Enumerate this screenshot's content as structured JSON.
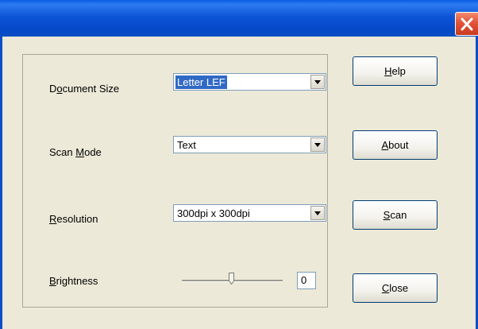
{
  "dialog": {
    "close_icon": "close-icon",
    "title_color": "#0a53d0",
    "close_color": "#e2553a"
  },
  "settings": {
    "document_size": {
      "label_pre": "D",
      "label_key": "o",
      "label_post": "cument Size",
      "value": "Letter LEF"
    },
    "scan_mode": {
      "label_pre": "Scan ",
      "label_key": "M",
      "label_post": "ode",
      "value": "Text"
    },
    "resolution": {
      "label_pre": "",
      "label_key": "R",
      "label_post": "esolution",
      "value": "300dpi x 300dpi"
    },
    "brightness": {
      "label_pre": "",
      "label_key": "B",
      "label_post": "rightness",
      "value": "0",
      "level": 0
    }
  },
  "buttons": {
    "help": {
      "key": "H",
      "rest": "elp"
    },
    "about": {
      "key": "A",
      "rest": "bout"
    },
    "scan": {
      "key": "S",
      "rest": "can"
    },
    "close": {
      "key": "C",
      "rest": "lose"
    }
  }
}
